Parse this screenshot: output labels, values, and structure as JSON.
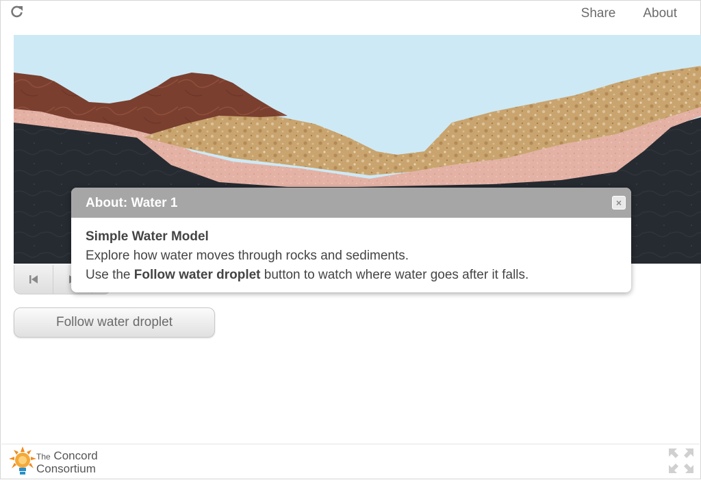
{
  "nav": {
    "share": "Share",
    "about": "About",
    "reload_icon": "reload-icon"
  },
  "controls": {
    "reset_icon": "skip-back-icon",
    "play_icon": "play-icon"
  },
  "follow_button": "Follow water droplet",
  "dialog": {
    "title": "About: Water 1",
    "close_glyph": "×",
    "heading": "Simple Water Model",
    "line1": "Explore how water moves through rocks and sediments.",
    "line2_before": "Use the ",
    "line2_bold": "Follow water droplet",
    "line2_after": " button to watch where water goes after it falls."
  },
  "footer": {
    "logo_the": "The",
    "logo_line1": "Concord",
    "logo_line2": "Consortium",
    "fullscreen_icon": "fullscreen-icon"
  },
  "colors": {
    "sky": "#cde9f5",
    "brown_rock": "#7a3f2f",
    "sand": "#c9a46e",
    "pink_layer": "#e7b6aa",
    "bedrock": "#262b31",
    "dialog_header": "#a6a6a6",
    "logo_orange": "#f08a1e"
  }
}
